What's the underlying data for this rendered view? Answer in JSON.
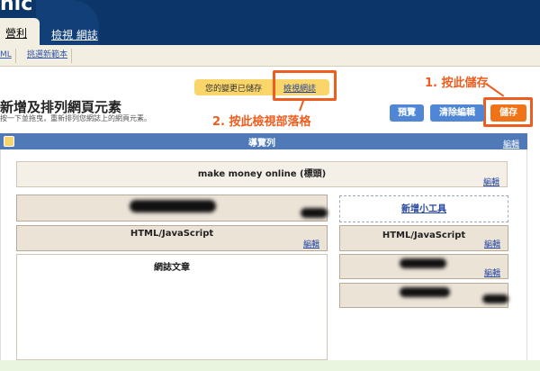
{
  "header": {
    "brand_fragment": "nic",
    "tabs": [
      {
        "label": "營利"
      },
      {
        "label": "檢視 網誌"
      }
    ]
  },
  "subnav": {
    "items": [
      "ML",
      "挑選新範本"
    ]
  },
  "status": {
    "saved_text": "您的變更已儲存",
    "view_blog_link": "檢視網誌"
  },
  "annotations": {
    "step1": "1. 按此儲存",
    "step2": "2. 按此檢視部落格"
  },
  "page": {
    "title": "新增及排列網頁元素",
    "subtitle": "按一下並拖曳，重新排列您網誌上的網頁元素。"
  },
  "buttons": {
    "preview": "預覽",
    "clear_edit": "清除編輯",
    "save": "儲存"
  },
  "navbar": {
    "title": "導覽列",
    "edit": "編輯"
  },
  "layout": {
    "header_widget": {
      "label": "make money online (標頭)",
      "edit": "編輯"
    },
    "html_widget_left": {
      "label": "HTML/JavaScript",
      "edit": "編輯"
    },
    "blog_posts": {
      "label": "網誌文章"
    },
    "add_gadget": {
      "label": "新增小工具"
    },
    "html_widget_right": {
      "label": "HTML/JavaScript",
      "edit": "編輯"
    },
    "edit_label": "編輯"
  }
}
